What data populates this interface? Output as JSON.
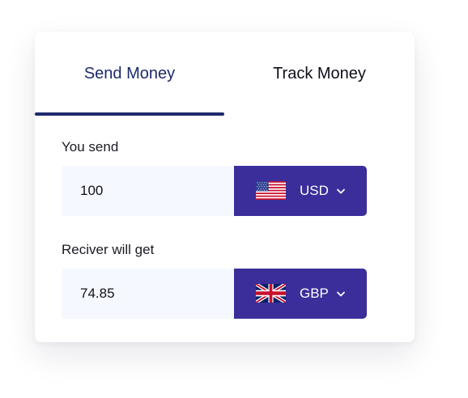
{
  "tabs": {
    "send_label": "Send Money",
    "track_label": "Track Money",
    "active": "Send Money"
  },
  "send": {
    "label": "You send",
    "amount": "100",
    "currency": "USD",
    "flag_icon": "us-flag-icon"
  },
  "receive": {
    "label": "Reciver will get",
    "amount": "74.85",
    "currency": "GBP",
    "flag_icon": "uk-flag-icon"
  },
  "colors": {
    "active_tab": "#1d2a6b",
    "currency_button": "#3b2e9b",
    "input_background": "#f6f8ff"
  }
}
